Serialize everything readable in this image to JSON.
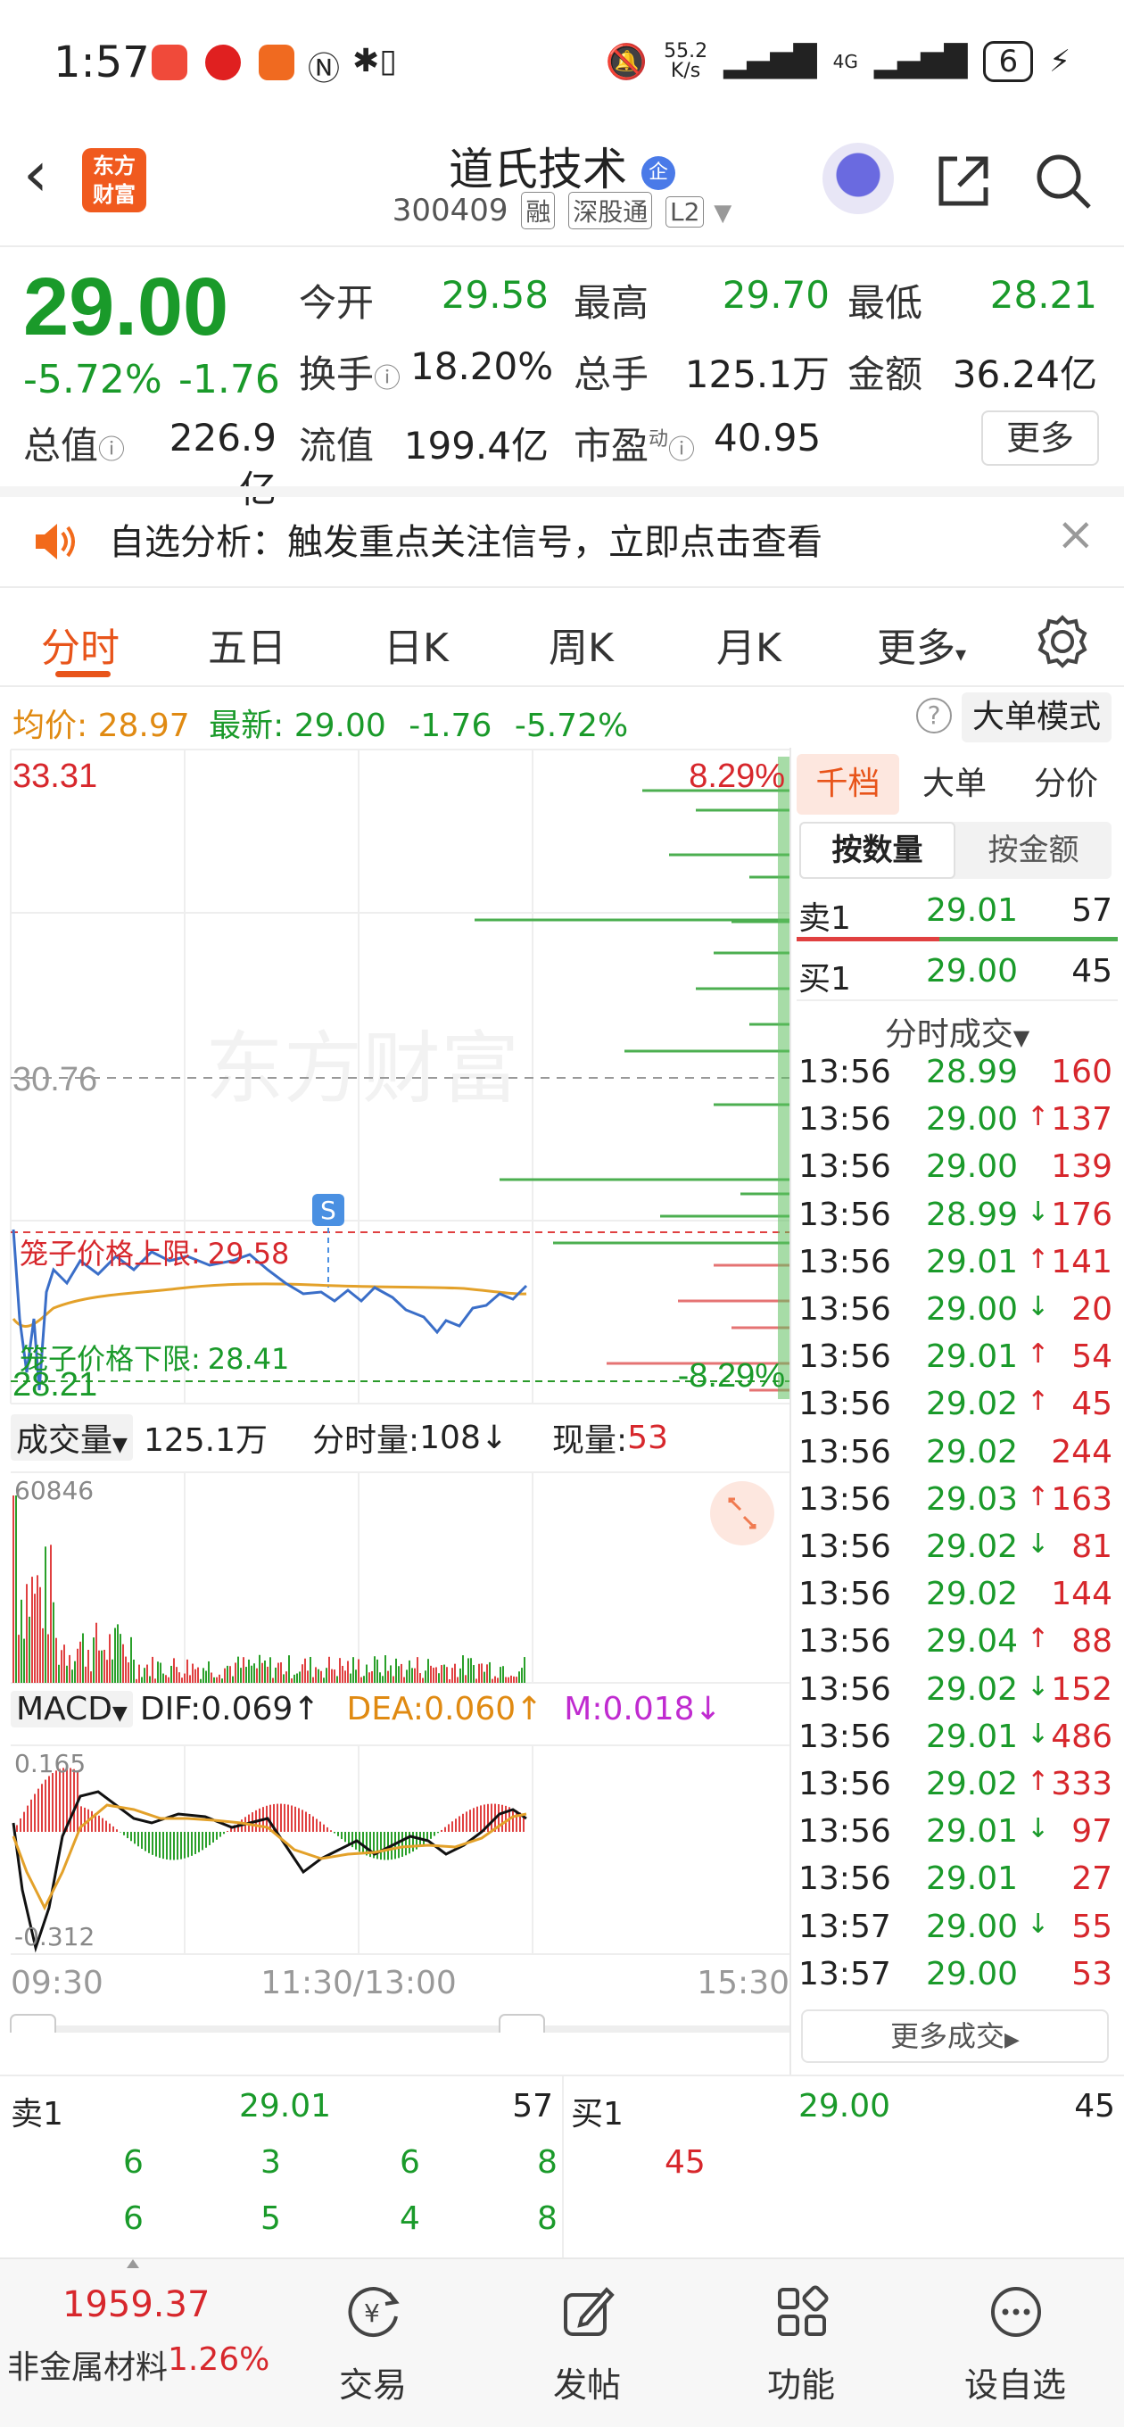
{
  "status_bar": {
    "time": "1:57",
    "speed_value": "55.2",
    "speed_unit": "K/s",
    "net_4g_1": "4G",
    "net_4g_2": "4G",
    "battery": "6"
  },
  "header": {
    "brand_logo_line1": "东方",
    "brand_logo_line2": "财富",
    "stock_name": "道氏技术",
    "name_badge": "企",
    "stock_code": "300409",
    "tags": [
      "融",
      "深股通",
      "L2"
    ]
  },
  "quote": {
    "price": "29.00",
    "change_pct": "-5.72%",
    "change_amt": "-1.76",
    "open_label": "今开",
    "open_value": "29.58",
    "high_label": "最高",
    "high_value": "29.70",
    "low_label": "最低",
    "low_value": "28.21",
    "turnover_label": "换手",
    "turnover_value": "18.20%",
    "volume_label": "总手",
    "volume_value": "125.1万",
    "amount_label": "金额",
    "amount_value": "36.24亿",
    "mktcap_label": "总值",
    "mktcap_value": "226.9亿",
    "float_label": "流值",
    "float_value": "199.4亿",
    "pe_label": "市盈",
    "pe_sup": "动",
    "pe_value": "40.95",
    "more_button": "更多"
  },
  "alert": {
    "text": "自选分析：触发重点关注信号，立即点击查看"
  },
  "tabs": [
    "分时",
    "五日",
    "日K",
    "周K",
    "月K",
    "更多"
  ],
  "info_line": {
    "avg_label": "均价:",
    "avg_value": "28.97",
    "latest_label": "最新:",
    "latest_value": "29.00",
    "change_amt": "-1.76",
    "change_pct": "-5.72%",
    "big_order_mode": "大单模式"
  },
  "intraday_chart": {
    "y_max": "33.31",
    "y_mid": "30.76",
    "y_min": "28.21",
    "pct_max": "8.29%",
    "pct_min": "-8.29%",
    "upper_limit_label": "笼子价格上限:",
    "upper_limit_value": "29.58",
    "lower_limit_label": "笼子价格下限:",
    "lower_limit_value": "28.41",
    "watermark": "东方财富",
    "signal_marker": "S"
  },
  "volume_bar": {
    "selector": "成交量",
    "total": "125.1万",
    "period_label": "分时量:",
    "period_value": "108",
    "current_label": "现量:",
    "current_value": "53",
    "max_tick": "60846"
  },
  "macd": {
    "selector": "MACD",
    "dif_label": "DIF:",
    "dif_value": "0.069",
    "dea_label": "DEA:",
    "dea_value": "0.060",
    "m_label": "M:",
    "m_value": "0.018",
    "top_tick": "0.165",
    "bottom_tick": "-0.312"
  },
  "time_axis": [
    "09:30",
    "11:30/13:00",
    "15:30"
  ],
  "side_panel": {
    "tabs": [
      "千档",
      "大单",
      "分价"
    ],
    "sub_tabs": [
      "按数量",
      "按金额"
    ],
    "sell1": {
      "label": "卖1",
      "price": "29.01",
      "qty": "57"
    },
    "buy1": {
      "label": "买1",
      "price": "29.00",
      "qty": "45"
    },
    "ticks_title": "分时成交",
    "ticks": [
      {
        "time": "13:56",
        "price": "28.99",
        "arrow": "",
        "vol": "160",
        "pc": "green"
      },
      {
        "time": "13:56",
        "price": "29.00",
        "arrow": "↑",
        "vol": "137",
        "pc": "green"
      },
      {
        "time": "13:56",
        "price": "29.00",
        "arrow": "",
        "vol": "139",
        "pc": "green"
      },
      {
        "time": "13:56",
        "price": "28.99",
        "arrow": "↓",
        "vol": "176",
        "pc": "green"
      },
      {
        "time": "13:56",
        "price": "29.01",
        "arrow": "↑",
        "vol": "141",
        "pc": "green"
      },
      {
        "time": "13:56",
        "price": "29.00",
        "arrow": "↓",
        "vol": "20",
        "pc": "green"
      },
      {
        "time": "13:56",
        "price": "29.01",
        "arrow": "↑",
        "vol": "54",
        "pc": "green"
      },
      {
        "time": "13:56",
        "price": "29.02",
        "arrow": "↑",
        "vol": "45",
        "pc": "green"
      },
      {
        "time": "13:56",
        "price": "29.02",
        "arrow": "",
        "vol": "244",
        "pc": "green"
      },
      {
        "time": "13:56",
        "price": "29.03",
        "arrow": "↑",
        "vol": "163",
        "pc": "green"
      },
      {
        "time": "13:56",
        "price": "29.02",
        "arrow": "↓",
        "vol": "81",
        "pc": "green"
      },
      {
        "time": "13:56",
        "price": "29.02",
        "arrow": "",
        "vol": "144",
        "pc": "green"
      },
      {
        "time": "13:56",
        "price": "29.04",
        "arrow": "↑",
        "vol": "88",
        "pc": "green"
      },
      {
        "time": "13:56",
        "price": "29.02",
        "arrow": "↓",
        "vol": "152",
        "pc": "green"
      },
      {
        "time": "13:56",
        "price": "29.01",
        "arrow": "↓",
        "vol": "486",
        "pc": "green"
      },
      {
        "time": "13:56",
        "price": "29.02",
        "arrow": "↑",
        "vol": "333",
        "pc": "green"
      },
      {
        "time": "13:56",
        "price": "29.01",
        "arrow": "↓",
        "vol": "97",
        "pc": "green"
      },
      {
        "time": "13:56",
        "price": "29.01",
        "arrow": "",
        "vol": "27",
        "pc": "green"
      },
      {
        "time": "13:57",
        "price": "29.00",
        "arrow": "↓",
        "vol": "55",
        "pc": "green"
      },
      {
        "time": "13:57",
        "price": "29.00",
        "arrow": "",
        "vol": "53",
        "pc": "green"
      }
    ],
    "more_ticks": "更多成交"
  },
  "bottom_book": {
    "sell_label": "卖1",
    "sell_price": "29.01",
    "sell_qty": "57",
    "buy_label": "买1",
    "buy_price": "29.00",
    "buy_qty": "45",
    "sell_queue_row1": [
      "6",
      "3",
      "6",
      "8"
    ],
    "sell_queue_row2": [
      "6",
      "5",
      "4",
      "8"
    ],
    "buy_queue_row1": [
      "45"
    ]
  },
  "bottom_nav": {
    "index_value": "1959.37",
    "index_name": "非金属材料",
    "index_change": "1.26%",
    "items": [
      "交易",
      "发帖",
      "功能",
      "设自选"
    ]
  }
}
